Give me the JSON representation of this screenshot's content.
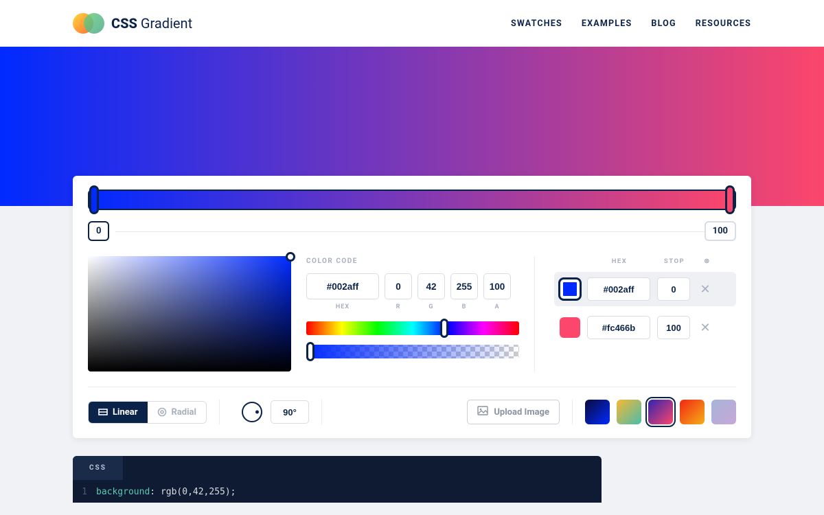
{
  "header": {
    "brand_bold": "CSS",
    "brand_rest": " Gradient",
    "nav": [
      "SWATCHES",
      "EXAMPLES",
      "BLOG",
      "RESOURCES"
    ]
  },
  "slider": {
    "left_value": "0",
    "right_value": "100"
  },
  "color_code": {
    "section_label": "COLOR CODE",
    "hex": "#002aff",
    "r": "0",
    "g": "42",
    "b": "255",
    "a": "100",
    "labels": {
      "hex": "HEX",
      "r": "R",
      "g": "G",
      "b": "B",
      "a": "A"
    }
  },
  "stops": {
    "headers": {
      "hex": "HEX",
      "stop": "STOP",
      "del": "⊗"
    },
    "rows": [
      {
        "color": "#002aff",
        "hex": "#002aff",
        "pos": "0",
        "active": true
      },
      {
        "color": "#fc466b",
        "hex": "#fc466b",
        "pos": "100",
        "active": false
      }
    ]
  },
  "controls": {
    "linear_label": "Linear",
    "radial_label": "Radial",
    "angle": "90°",
    "upload_label": "Upload Image"
  },
  "presets": [
    "linear-gradient(135deg,#0b0b3b,#002aff)",
    "linear-gradient(135deg,#f7b733,#4abdac)",
    "linear-gradient(135deg,#3023ae,#fc466b)",
    "linear-gradient(135deg,#f12711,#f5af19)",
    "linear-gradient(135deg,#a7b4d8,#c7a7d8)"
  ],
  "code": {
    "tab": "CSS",
    "line1_num": "1",
    "line1_prop": "background",
    "line1_val": "rgb(0,42,255);"
  }
}
